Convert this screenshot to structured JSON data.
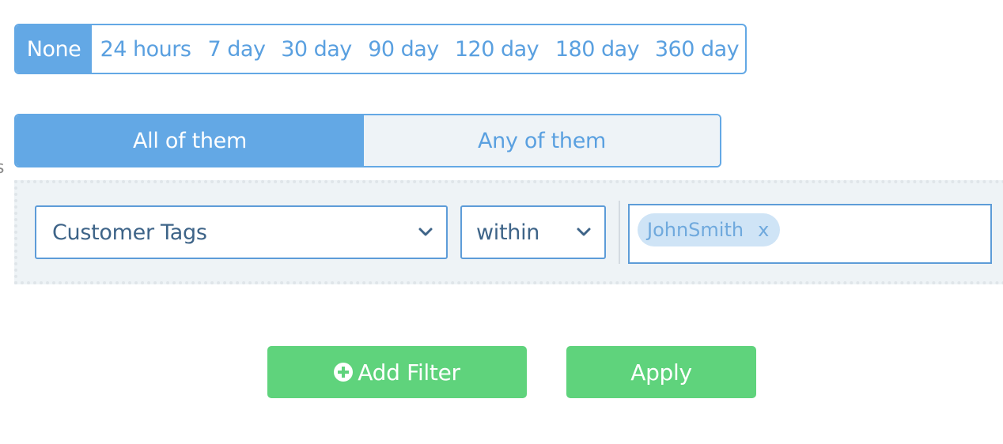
{
  "edge_fragment": "s",
  "time_range": {
    "options": [
      {
        "label": "None",
        "active": true
      },
      {
        "label": "24 hours",
        "active": false
      },
      {
        "label": "7 day",
        "active": false
      },
      {
        "label": "30 day",
        "active": false
      },
      {
        "label": "90 day",
        "active": false
      },
      {
        "label": "120 day",
        "active": false
      },
      {
        "label": "180 day",
        "active": false
      },
      {
        "label": "360 day",
        "active": false
      }
    ]
  },
  "match_toggle": {
    "all_label": "All of them",
    "any_label": "Any of them",
    "selected": "all"
  },
  "filter": {
    "field": {
      "value": "Customer Tags",
      "icon": "chevron-down-icon"
    },
    "operator": {
      "value": "within",
      "icon": "chevron-down-icon"
    },
    "tags": [
      {
        "label": "JohnSmith",
        "remove_label": "x"
      }
    ]
  },
  "buttons": {
    "add_filter": {
      "label": "Add Filter",
      "icon": "plus-circle-icon"
    },
    "apply": {
      "label": "Apply"
    }
  },
  "colors": {
    "accent_blue": "#63a8e5",
    "button_green": "#5fd37c",
    "chip_bg": "#cfe4f6",
    "panel_bg": "#eef3f6"
  }
}
